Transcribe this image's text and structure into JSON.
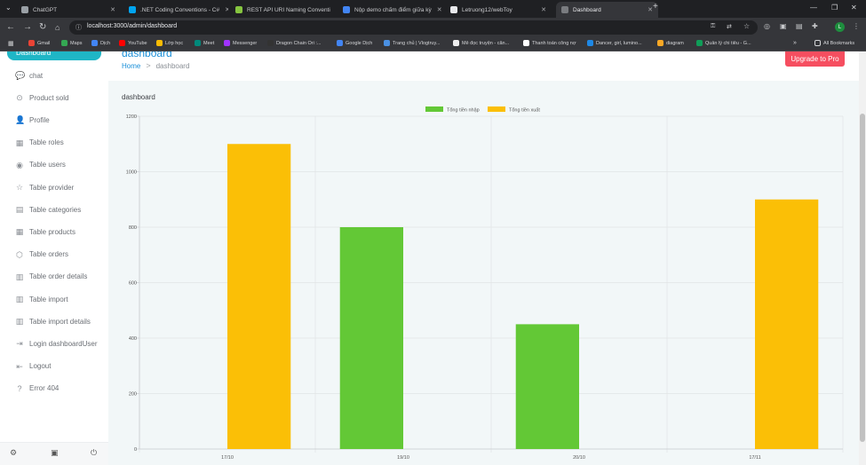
{
  "browser": {
    "tabs": [
      {
        "title": "ChatGPT",
        "color": "#9aa0a6"
      },
      {
        "title": ".NET Coding Conventions - C#",
        "color": "#00a4ef"
      },
      {
        "title": "REST API URI Naming Conventi",
        "color": "#86c540"
      },
      {
        "title": "Nộp demo chấm điểm giữa kỳ",
        "color": "#4285f4"
      },
      {
        "title": "Letruong12/webToy",
        "color": "#e8e9ec"
      },
      {
        "title": "Dashboard",
        "color": "#7a7c80"
      }
    ],
    "new_tab": "+",
    "url": "localhost:3000/admin/dashboard",
    "profile_initial": "L",
    "bookmarks": [
      {
        "label": "Gmail",
        "color": "#ea4335"
      },
      {
        "label": "Maps",
        "color": "#34a853"
      },
      {
        "label": "Dịch",
        "color": "#4285f4"
      },
      {
        "label": "YouTube",
        "color": "#ff0000"
      },
      {
        "label": "Lớp học",
        "color": "#fbbc04"
      },
      {
        "label": "Meet",
        "color": "#00897b"
      },
      {
        "label": "Messenger",
        "color": "#a033ff"
      },
      {
        "label": "Dragon Chain Ori :...",
        "color": "#333333"
      },
      {
        "label": "Google Dịch",
        "color": "#4285f4"
      },
      {
        "label": "Trang chủ | Vlogtruy...",
        "color": "#4a90e2"
      },
      {
        "label": "Mê đọc truyện - căn...",
        "color": "#eeeeee"
      },
      {
        "label": "Thanh toán công nợ",
        "color": "#ffffff"
      },
      {
        "label": "Dancer, girl, lumino...",
        "color": "#1e88e5"
      },
      {
        "label": "diagram",
        "color": "#f9a825"
      },
      {
        "label": "Quản lý chi tiêu - G...",
        "color": "#0f9d58"
      }
    ],
    "more": "»",
    "all_bookmarks": "All Bookmarks"
  },
  "sidebar": {
    "active_item": "Dashboard",
    "items": [
      {
        "label": "chat",
        "icon": "chat-icon",
        "glyph": "💬"
      },
      {
        "label": "Product sold",
        "icon": "cart-icon",
        "glyph": "⊙"
      },
      {
        "label": "Profile",
        "icon": "profile-icon",
        "glyph": "👤"
      },
      {
        "label": "Table roles",
        "icon": "table-icon",
        "glyph": "▦"
      },
      {
        "label": "Table users",
        "icon": "user-circle-icon",
        "glyph": "◉"
      },
      {
        "label": "Table provider",
        "icon": "star-icon",
        "glyph": "☆"
      },
      {
        "label": "Table categories",
        "icon": "book-icon",
        "glyph": "▤"
      },
      {
        "label": "Table products",
        "icon": "grid-icon",
        "glyph": "▦"
      },
      {
        "label": "Table orders",
        "icon": "box-icon",
        "glyph": "⬡"
      },
      {
        "label": "Table order details",
        "icon": "book-open-icon",
        "glyph": "▥"
      },
      {
        "label": "Table import",
        "icon": "book-open-icon",
        "glyph": "▥"
      },
      {
        "label": "Table import details",
        "icon": "book-open-icon",
        "glyph": "▥"
      },
      {
        "label": "Login dashboardUser",
        "icon": "login-icon",
        "glyph": "⇥"
      },
      {
        "label": "Logout",
        "icon": "logout-icon",
        "glyph": "⇤"
      },
      {
        "label": "Error 404",
        "icon": "help-icon",
        "glyph": "?"
      }
    ]
  },
  "header": {
    "title": "dashboard",
    "breadcrumb_home": "Home",
    "breadcrumb_sep": ">",
    "breadcrumb_current": "dashboard",
    "upgrade_label": "Upgrade to Pro"
  },
  "main": {
    "label": "dashboard"
  },
  "colors": {
    "import": "#63c836",
    "export": "#fbbf06",
    "accent": "#1fb6c6",
    "upgrade": "#f64e60"
  },
  "chart_data": {
    "type": "bar",
    "categories": [
      "17/10",
      "19/10",
      "20/10",
      "17/11"
    ],
    "series": [
      {
        "name": "Tổng tiền nhập",
        "values": [
          0,
          800,
          450,
          0
        ],
        "color": "#63c836"
      },
      {
        "name": "Tổng tiền xuất",
        "values": [
          1100,
          0,
          0,
          900
        ],
        "color": "#fbbf06"
      }
    ],
    "yticks": [
      0,
      200,
      400,
      600,
      800,
      1000,
      1200
    ],
    "ylim": [
      0,
      1200
    ],
    "legend": "top-center",
    "grid": true
  }
}
